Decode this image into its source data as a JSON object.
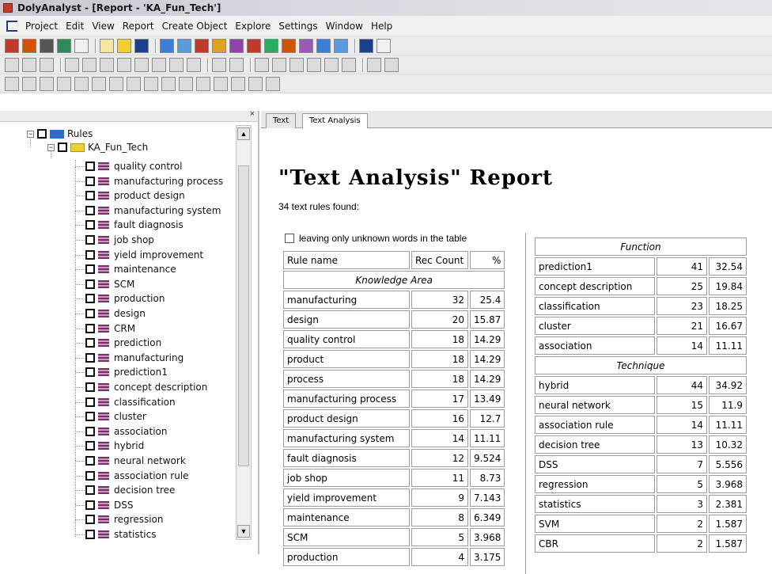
{
  "window": {
    "title": "DolyAnalyst - [Report - 'KA_Fun_Tech']"
  },
  "menu": [
    "Project",
    "Edit",
    "View",
    "Report",
    "Create Object",
    "Explore",
    "Settings",
    "Window",
    "Help"
  ],
  "tree": {
    "root_label": "Rules",
    "folder_label": "KA_Fun_Tech",
    "items": [
      "quality control",
      "manufacturing process",
      "product design",
      "manufacturing system",
      "fault diagnosis",
      "job shop",
      "yield improvement",
      "maintenance",
      "SCM",
      "production",
      "design",
      "CRM",
      "prediction",
      "manufacturing",
      "prediction1",
      "concept description",
      "classification",
      "cluster",
      "association",
      "hybrid",
      "neural network",
      "association rule",
      "decision tree",
      "DSS",
      "regression",
      "statistics"
    ]
  },
  "tabs": [
    "Text",
    "Text Analysis"
  ],
  "report": {
    "title": "\"Text Analysis\" Report",
    "found": "34 text rules found:",
    "leaving_label": "leaving only unknown words in the table",
    "headers": {
      "name": "Rule name",
      "count": "Rec Count",
      "pct": "%"
    },
    "knowledge_area": {
      "label": "Knowledge Area",
      "rows": [
        {
          "name": "manufacturing",
          "count": "32",
          "pct": "25.4"
        },
        {
          "name": "design",
          "count": "20",
          "pct": "15.87"
        },
        {
          "name": "quality control",
          "count": "18",
          "pct": "14.29"
        },
        {
          "name": "product",
          "count": "18",
          "pct": "14.29"
        },
        {
          "name": "process",
          "count": "18",
          "pct": "14.29"
        },
        {
          "name": "manufacturing process",
          "count": "17",
          "pct": "13.49"
        },
        {
          "name": "product design",
          "count": "16",
          "pct": "12.7"
        },
        {
          "name": "manufacturing system",
          "count": "14",
          "pct": "11.11"
        },
        {
          "name": "fault diagnosis",
          "count": "12",
          "pct": "9.524"
        },
        {
          "name": "job shop",
          "count": "11",
          "pct": "8.73"
        },
        {
          "name": "yield improvement",
          "count": "9",
          "pct": "7.143"
        },
        {
          "name": "maintenance",
          "count": "8",
          "pct": "6.349"
        },
        {
          "name": "SCM",
          "count": "5",
          "pct": "3.968"
        },
        {
          "name": "production",
          "count": "4",
          "pct": "3.175"
        }
      ]
    },
    "function": {
      "label": "Function",
      "rows": [
        {
          "name": "prediction1",
          "count": "41",
          "pct": "32.54"
        },
        {
          "name": "concept description",
          "count": "25",
          "pct": "19.84"
        },
        {
          "name": "classification",
          "count": "23",
          "pct": "18.25"
        },
        {
          "name": "cluster",
          "count": "21",
          "pct": "16.67"
        },
        {
          "name": "association",
          "count": "14",
          "pct": "11.11"
        }
      ]
    },
    "technique": {
      "label": "Technique",
      "rows": [
        {
          "name": "hybrid",
          "count": "44",
          "pct": "34.92"
        },
        {
          "name": "neural network",
          "count": "15",
          "pct": "11.9"
        },
        {
          "name": "association rule",
          "count": "14",
          "pct": "11.11"
        },
        {
          "name": "decision tree",
          "count": "13",
          "pct": "10.32"
        },
        {
          "name": "DSS",
          "count": "7",
          "pct": "5.556"
        },
        {
          "name": "regression",
          "count": "5",
          "pct": "3.968"
        },
        {
          "name": "statistics",
          "count": "3",
          "pct": "2.381"
        },
        {
          "name": "SVM",
          "count": "2",
          "pct": "1.587"
        },
        {
          "name": "CBR",
          "count": "2",
          "pct": "1.587"
        }
      ]
    }
  }
}
